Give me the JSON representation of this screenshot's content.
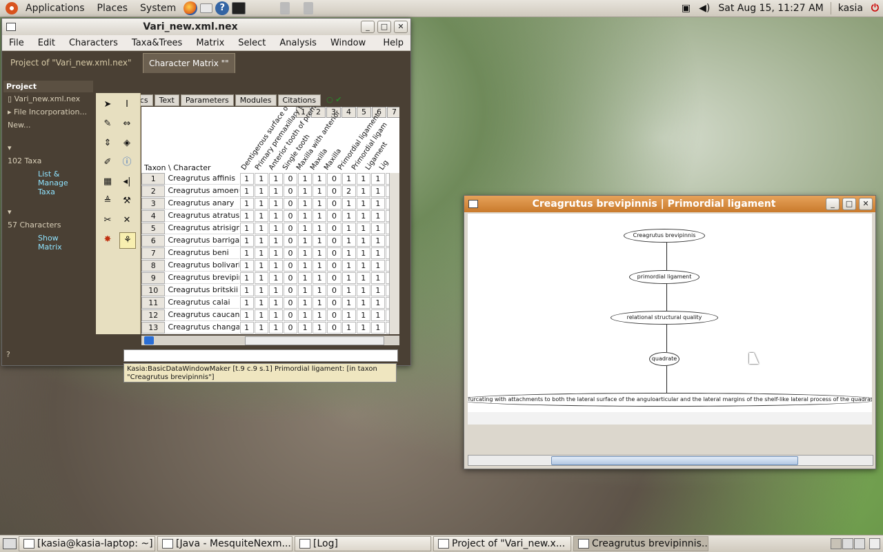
{
  "top_panel": {
    "menus": [
      "Applications",
      "Places",
      "System"
    ],
    "datetime": "Sat Aug 15, 11:27 AM",
    "user": "kasia"
  },
  "main_window": {
    "title": "Vari_new.xml.nex",
    "menus": [
      "File",
      "Edit",
      "Characters",
      "Taxa&Trees",
      "Matrix",
      "Select",
      "Analysis",
      "Window",
      "Help"
    ],
    "tabs": [
      "Project of \"Vari_new.xml.nex\"",
      "Character Matrix \"\""
    ],
    "project_panel": {
      "header": "Project",
      "file": "Vari_new.xml.nex",
      "incorporation": "File Incorporation...",
      "new": "New...",
      "taxa_count": "102 Taxa",
      "taxa_link": "List & Manage Taxa",
      "char_count": "57 Characters",
      "char_link": "Show Matrix"
    },
    "sub_tabs": [
      "Graphics",
      "Text",
      "Parameters",
      "Modules",
      "Citations"
    ],
    "matrix": {
      "corner": "Taxon \\ Character",
      "col_numbers": [
        "1",
        "2",
        "3",
        "4",
        "5",
        "6",
        "7"
      ],
      "char_names": [
        "Dentigerous surface o",
        "Primary premaxillary t",
        "Anterior tooth of prem",
        "Single tooth",
        "Maxilla with anterior",
        "Maxilla",
        "Maxilla",
        "Primordial ligament",
        "Primordial ligam",
        "Ligament",
        "Lig"
      ],
      "rows": [
        {
          "n": "1",
          "name": "Creagrutus affinis",
          "vals": [
            "1",
            "1",
            "1",
            "0",
            "1",
            "1",
            "0",
            "1",
            "1",
            "1",
            "1"
          ]
        },
        {
          "n": "2",
          "name": "Creagrutus amoenus",
          "vals": [
            "1",
            "1",
            "1",
            "0",
            "1",
            "1",
            "0",
            "2",
            "1",
            "1",
            "1"
          ]
        },
        {
          "n": "3",
          "name": "Creagrutus anary",
          "vals": [
            "1",
            "1",
            "1",
            "0",
            "1",
            "1",
            "0",
            "1",
            "1",
            "1",
            "1"
          ]
        },
        {
          "n": "4",
          "name": "Creagrutus atratus",
          "vals": [
            "1",
            "1",
            "1",
            "0",
            "1",
            "1",
            "0",
            "1",
            "1",
            "1",
            "1"
          ]
        },
        {
          "n": "5",
          "name": "Creagrutus atrisignun",
          "vals": [
            "1",
            "1",
            "1",
            "0",
            "1",
            "1",
            "0",
            "1",
            "1",
            "1",
            "1"
          ]
        },
        {
          "n": "6",
          "name": "Creagrutus barrigai",
          "vals": [
            "1",
            "1",
            "1",
            "0",
            "1",
            "1",
            "0",
            "1",
            "1",
            "1",
            "1"
          ]
        },
        {
          "n": "7",
          "name": "Creagrutus beni",
          "vals": [
            "1",
            "1",
            "1",
            "0",
            "1",
            "1",
            "0",
            "1",
            "1",
            "1",
            "1"
          ]
        },
        {
          "n": "8",
          "name": "Creagrutus bolivari",
          "vals": [
            "1",
            "1",
            "1",
            "0",
            "1",
            "1",
            "0",
            "1",
            "1",
            "1",
            "1"
          ]
        },
        {
          "n": "9",
          "name": "Creagrutus brevipinni",
          "vals": [
            "1",
            "1",
            "1",
            "0",
            "1",
            "1",
            "0",
            "1",
            "1",
            "1",
            "1"
          ]
        },
        {
          "n": "10",
          "name": "Creagrutus britskii",
          "vals": [
            "1",
            "1",
            "1",
            "0",
            "1",
            "1",
            "0",
            "1",
            "1",
            "1",
            "1"
          ]
        },
        {
          "n": "11",
          "name": "Creagrutus calai",
          "vals": [
            "1",
            "1",
            "1",
            "0",
            "1",
            "1",
            "0",
            "1",
            "1",
            "1",
            "1"
          ]
        },
        {
          "n": "12",
          "name": "Creagrutus caucanus",
          "vals": [
            "1",
            "1",
            "1",
            "0",
            "1",
            "1",
            "0",
            "1",
            "1",
            "1",
            "1"
          ]
        },
        {
          "n": "13",
          "name": "Creagrutus changae",
          "vals": [
            "1",
            "1",
            "1",
            "0",
            "1",
            "1",
            "0",
            "1",
            "1",
            "1",
            "1"
          ]
        }
      ]
    },
    "status": "Kasia:BasicDataWindowMaker [t.9 c.9 s.1] Primordial ligament:   [in taxon \"Creagrutus brevipinnis\"]"
  },
  "graph_window": {
    "title": "Creagrutus brevipinnis  |  Primordial ligament",
    "nodes": [
      "Creagrutus brevipinnis",
      "primordial ligament",
      "relational structural quality",
      "quadrate"
    ],
    "long_node": "y bifurcating with attachments to both the lateral surface of the anguloarticular and the lateral margins of the shelf-like lateral process of the quadrate"
  },
  "taskbar": {
    "tasks": [
      "[kasia@kasia-laptop: ~]",
      "[Java - MesquiteNexm...",
      "[Log]",
      "Project of \"Vari_new.x...",
      "Creagrutus brevipinnis..."
    ]
  }
}
